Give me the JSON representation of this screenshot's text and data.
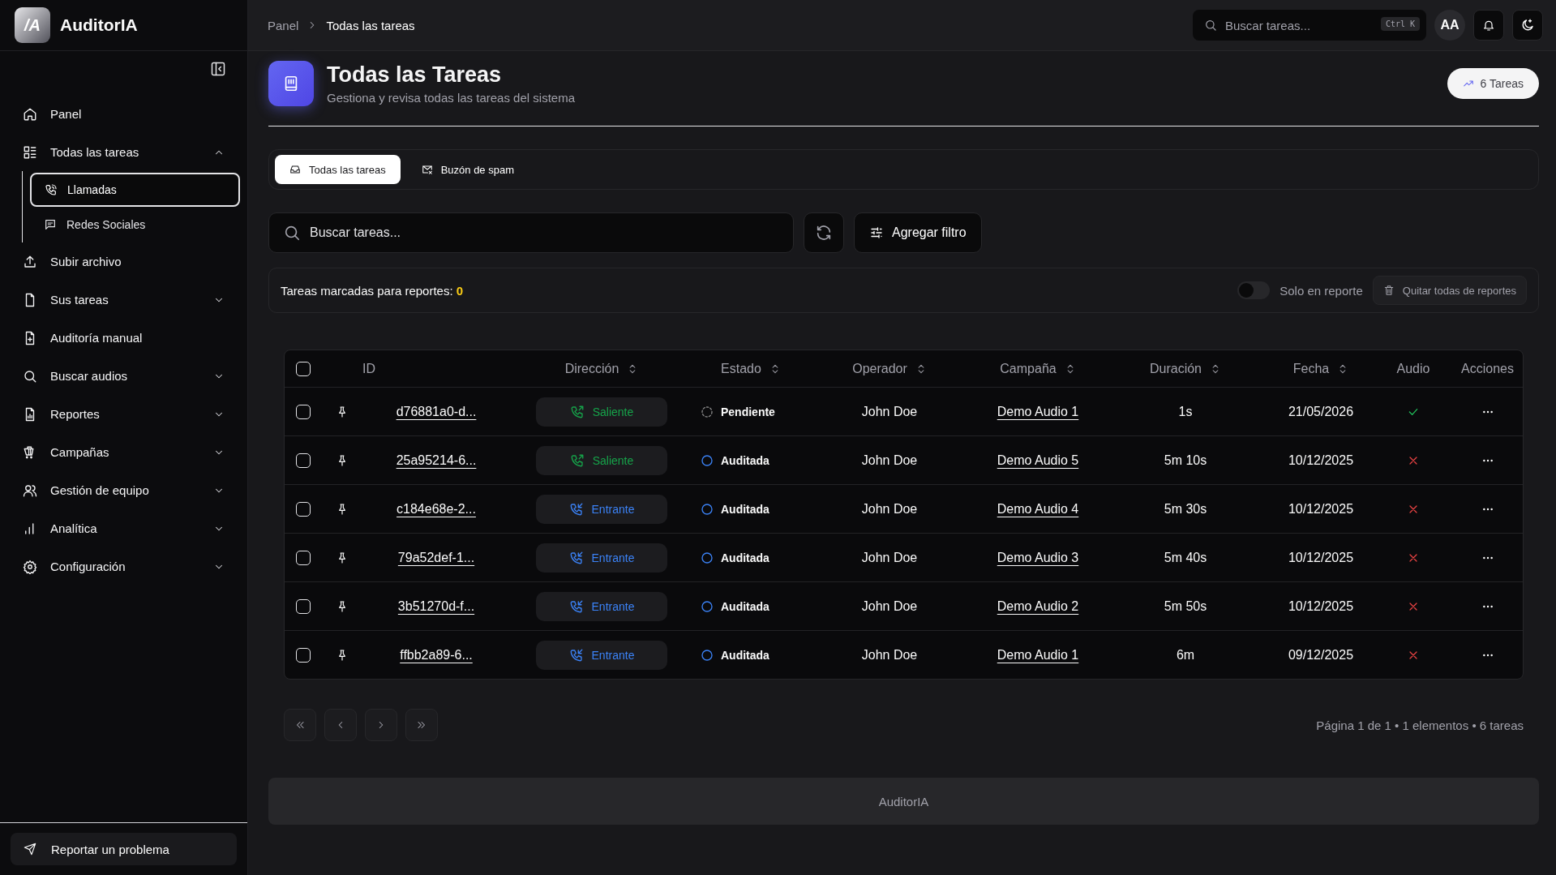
{
  "app": {
    "name": "AuditorIA",
    "logo_mark": "/A"
  },
  "sidebar": {
    "items": [
      {
        "kind": "link",
        "label": "Panel"
      },
      {
        "kind": "group",
        "label": "Todas las tareas",
        "expanded": true,
        "children": [
          {
            "label": "Llamadas",
            "selected": true
          },
          {
            "label": "Redes Sociales",
            "selected": false
          }
        ]
      },
      {
        "kind": "link",
        "label": "Subir archivo"
      },
      {
        "kind": "group",
        "label": "Sus tareas",
        "expanded": false
      },
      {
        "kind": "link",
        "label": "Auditoría manual"
      },
      {
        "kind": "group",
        "label": "Buscar audios",
        "expanded": false
      },
      {
        "kind": "group",
        "label": "Reportes",
        "expanded": false
      },
      {
        "kind": "group",
        "label": "Campañas",
        "expanded": false
      },
      {
        "kind": "group",
        "label": "Gestión de equipo",
        "expanded": false
      },
      {
        "kind": "group",
        "label": "Analítica",
        "expanded": false
      },
      {
        "kind": "group",
        "label": "Configuración",
        "expanded": false
      }
    ],
    "report_button": "Reportar un problema"
  },
  "topbar": {
    "breadcrumb": [
      "Panel",
      "Todas las tareas"
    ],
    "search": {
      "placeholder": "Buscar tareas...",
      "shortcut": "Ctrl K"
    },
    "avatar": "AA"
  },
  "page": {
    "title": "Todas las Tareas",
    "subtitle": "Gestiona y revisa todas las tareas del sistema",
    "count_badge": "6 Tareas"
  },
  "tabs": [
    {
      "label": "Todas las tareas",
      "selected": true
    },
    {
      "label": "Buzón de spam",
      "selected": false
    }
  ],
  "filters": {
    "search": {
      "placeholder": "Buscar tareas..."
    },
    "add_filter": "Agregar filtro"
  },
  "report_bar": {
    "label": "Tareas marcadas para reportes:",
    "count": "0",
    "toggle": {
      "label": "Solo en reporte",
      "on": false
    },
    "clear_button": "Quitar todas de reportes"
  },
  "table": {
    "header_checked": false,
    "columns": [
      {
        "label": "ID",
        "sortable": false
      },
      {
        "label": "Dirección",
        "sortable": true
      },
      {
        "label": "Estado",
        "sortable": true
      },
      {
        "label": "Operador",
        "sortable": true
      },
      {
        "label": "Campaña",
        "sortable": true
      },
      {
        "label": "Duración",
        "sortable": true
      },
      {
        "label": "Fecha",
        "sortable": true
      },
      {
        "label": "Audio",
        "sortable": false
      },
      {
        "label": "Acciones",
        "sortable": false
      }
    ],
    "rows": [
      {
        "checked": false,
        "id": "d76881a0-d...",
        "direction": {
          "kind": "outgoing",
          "label": "Saliente"
        },
        "status": {
          "kind": "pending",
          "label": "Pendiente"
        },
        "operator": "John Doe",
        "campaign": "Demo Audio 1",
        "duration": "1s",
        "date": "21/05/2026",
        "audio": true
      },
      {
        "checked": false,
        "id": "25a95214-6...",
        "direction": {
          "kind": "outgoing",
          "label": "Saliente"
        },
        "status": {
          "kind": "audited",
          "label": "Auditada"
        },
        "operator": "John Doe",
        "campaign": "Demo Audio 5",
        "duration": "5m 10s",
        "date": "10/12/2025",
        "audio": false
      },
      {
        "checked": false,
        "id": "c184e68e-2...",
        "direction": {
          "kind": "incoming",
          "label": "Entrante"
        },
        "status": {
          "kind": "audited",
          "label": "Auditada"
        },
        "operator": "John Doe",
        "campaign": "Demo Audio 4",
        "duration": "5m 30s",
        "date": "10/12/2025",
        "audio": false
      },
      {
        "checked": false,
        "id": "79a52def-1...",
        "direction": {
          "kind": "incoming",
          "label": "Entrante"
        },
        "status": {
          "kind": "audited",
          "label": "Auditada"
        },
        "operator": "John Doe",
        "campaign": "Demo Audio 3",
        "duration": "5m 40s",
        "date": "10/12/2025",
        "audio": false
      },
      {
        "checked": false,
        "id": "3b51270d-f...",
        "direction": {
          "kind": "incoming",
          "label": "Entrante"
        },
        "status": {
          "kind": "audited",
          "label": "Auditada"
        },
        "operator": "John Doe",
        "campaign": "Demo Audio 2",
        "duration": "5m 50s",
        "date": "10/12/2025",
        "audio": false
      },
      {
        "checked": false,
        "id": "ffbb2a89-6...",
        "direction": {
          "kind": "incoming",
          "label": "Entrante"
        },
        "status": {
          "kind": "audited",
          "label": "Auditada"
        },
        "operator": "John Doe",
        "campaign": "Demo Audio 1",
        "duration": "6m",
        "date": "09/12/2025",
        "audio": false
      }
    ]
  },
  "pagination": {
    "summary": "Página 1 de 1 • 1 elementos • 6 tareas"
  },
  "footer": {
    "text": "AuditorIA"
  }
}
